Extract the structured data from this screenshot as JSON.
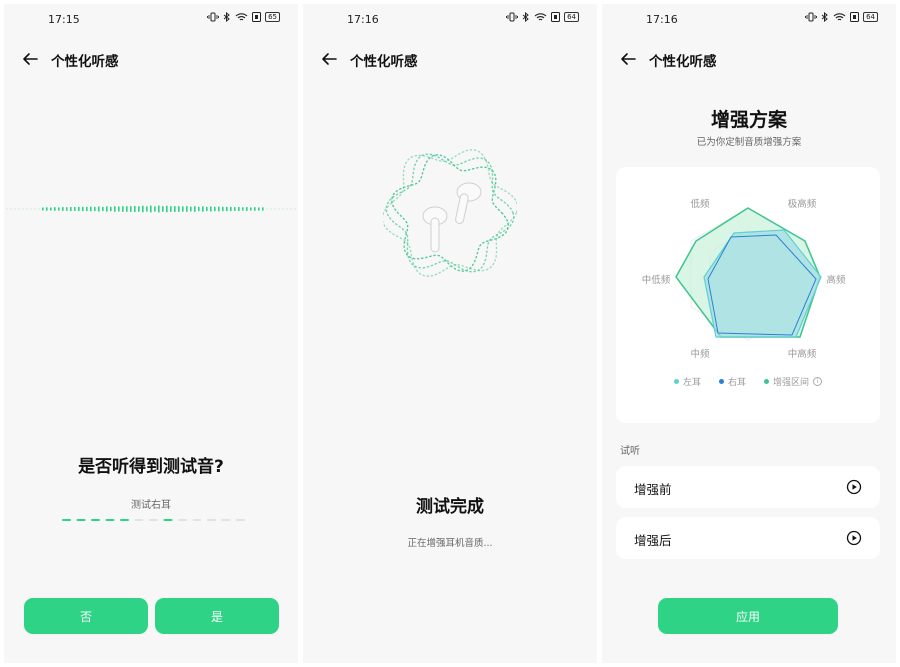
{
  "colors": {
    "accent": "#2ed386",
    "left_ear": "#5fd0d0",
    "right_ear": "#2d7fd6",
    "enhanced": "#3ec48e"
  },
  "panels": [
    {
      "status_time": "17:15",
      "battery": "65",
      "title": "个性化听感",
      "question": "是否听得到测试音?",
      "test_label": "测试右耳",
      "no_button": "否",
      "yes_button": "是"
    },
    {
      "status_time": "17:16",
      "battery": "64",
      "title": "个性化听感",
      "done_title": "测试完成",
      "done_sub": "正在增强耳机音质..."
    },
    {
      "status_time": "17:16",
      "battery": "64",
      "title": "个性化听感",
      "heading": "增强方案",
      "subheading": "已为你定制音质增强方案",
      "radar_labels": [
        "低频",
        "极高频",
        "中低频",
        "高频",
        "中频",
        "中高频"
      ],
      "legend": [
        "左耳",
        "右耳",
        "增强区间"
      ],
      "section_label": "试听",
      "rows": [
        "增强前",
        "增强后"
      ],
      "apply_button": "应用"
    }
  ]
}
